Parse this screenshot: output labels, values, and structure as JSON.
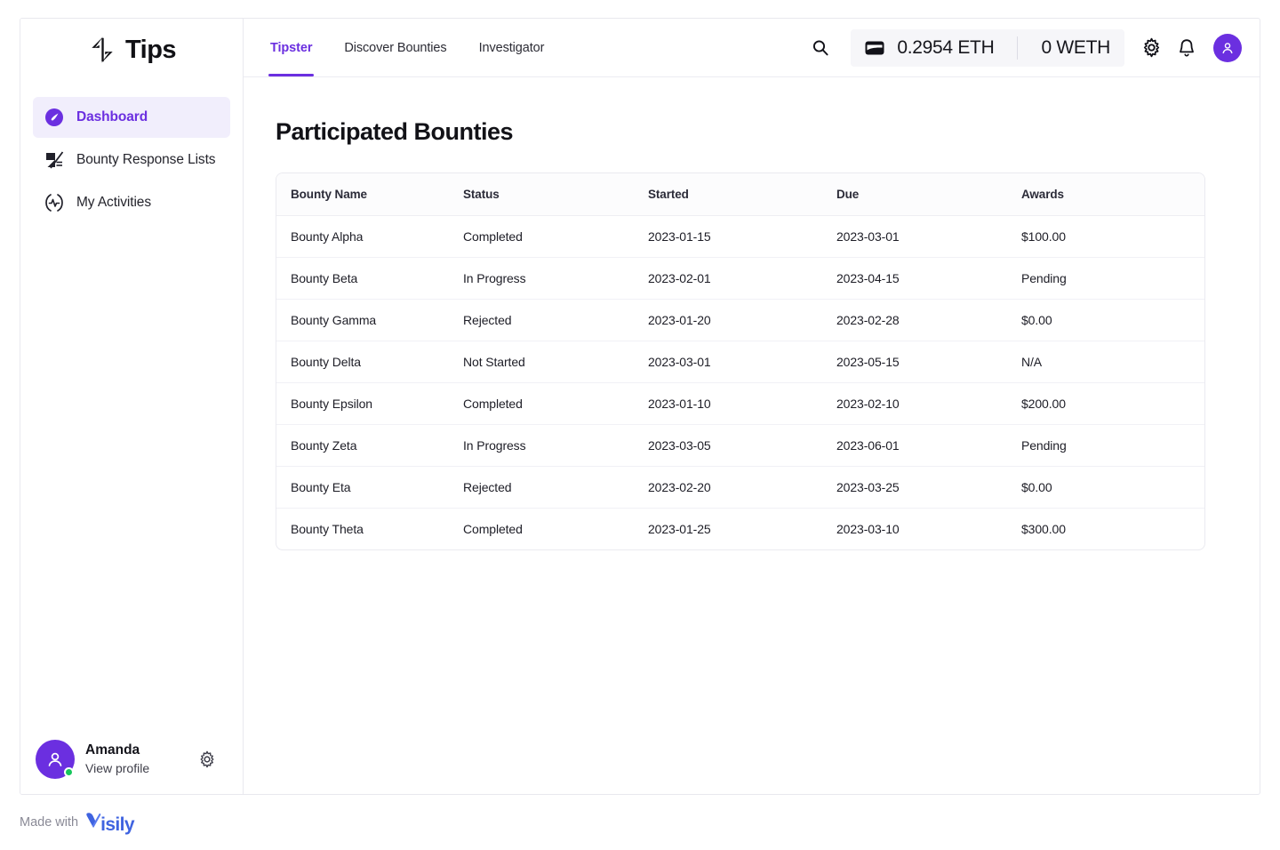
{
  "brand": {
    "name": "Tips",
    "logo_icon": "lightning-bolt-icon"
  },
  "sidebar": {
    "items": [
      {
        "label": "Dashboard",
        "icon": "speedometer-icon",
        "active": true
      },
      {
        "label": "Bounty Response Lists",
        "icon": "response-list-icon",
        "active": false
      },
      {
        "label": "My Activities",
        "icon": "activity-pulse-icon",
        "active": false
      }
    ],
    "profile": {
      "name": "Amanda",
      "subtitle": "View profile",
      "avatar_icon": "person-icon",
      "settings_icon": "gear-icon",
      "status": "online"
    }
  },
  "topbar": {
    "tabs": [
      {
        "label": "Tipster",
        "active": true
      },
      {
        "label": "Discover Bounties",
        "active": false
      },
      {
        "label": "Investigator",
        "active": false
      }
    ],
    "search_icon": "search-icon",
    "wallet": {
      "wallet_icon": "wallet-icon",
      "eth_balance": "0.2954 ETH",
      "weth_balance": "0 WETH"
    },
    "settings_icon": "gear-icon",
    "notifications_icon": "bell-icon",
    "avatar_icon": "person-icon"
  },
  "main": {
    "title": "Participated Bounties",
    "table": {
      "columns": [
        "Bounty Name",
        "Status",
        "Started",
        "Due",
        "Awards"
      ],
      "rows": [
        {
          "name": "Bounty Alpha",
          "status": "Completed",
          "started": "2023-01-15",
          "due": "2023-03-01",
          "awards": "$100.00"
        },
        {
          "name": "Bounty Beta",
          "status": "In Progress",
          "started": "2023-02-01",
          "due": "2023-04-15",
          "awards": "Pending"
        },
        {
          "name": "Bounty Gamma",
          "status": "Rejected",
          "started": "2023-01-20",
          "due": "2023-02-28",
          "awards": "$0.00"
        },
        {
          "name": "Bounty Delta",
          "status": "Not Started",
          "started": "2023-03-01",
          "due": "2023-05-15",
          "awards": "N/A"
        },
        {
          "name": "Bounty Epsilon",
          "status": "Completed",
          "started": "2023-01-10",
          "due": "2023-02-10",
          "awards": "$200.00"
        },
        {
          "name": "Bounty Zeta",
          "status": "In Progress",
          "started": "2023-03-05",
          "due": "2023-06-01",
          "awards": "Pending"
        },
        {
          "name": "Bounty Eta",
          "status": "Rejected",
          "started": "2023-02-20",
          "due": "2023-03-25",
          "awards": "$0.00"
        },
        {
          "name": "Bounty Theta",
          "status": "Completed",
          "started": "2023-01-25",
          "due": "2023-03-10",
          "awards": "$300.00"
        }
      ]
    }
  },
  "footer": {
    "made_with_text": "Made with",
    "brand_mark": "V",
    "brand_rest": "isily"
  },
  "colors": {
    "accent": "#6b2fe0",
    "accent_soft": "#f1eefc",
    "text": "#1d1d26",
    "muted": "#8a8a96",
    "status_online": "#16c65c",
    "visily_blue": "#3f63e0"
  }
}
